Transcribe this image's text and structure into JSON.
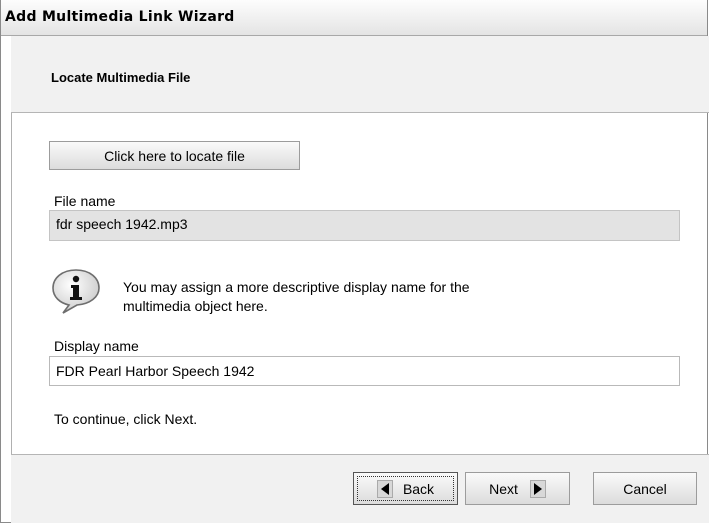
{
  "window": {
    "title": "Add Multimedia Link Wizard"
  },
  "header": {
    "heading": "Locate Multimedia File"
  },
  "body": {
    "locate_button_label": "Click here to locate file",
    "file_name_label": "File name",
    "file_name_value": "fdr speech 1942.mp3",
    "info_icon": "info-icon",
    "info_text": "You may assign a more descriptive display name for the multimedia object here.",
    "display_name_label": "Display name",
    "display_name_value": "FDR Pearl Harbor Speech 1942",
    "continue_text": "To continue, click Next."
  },
  "footer": {
    "back_label": "Back",
    "next_label": "Next",
    "cancel_label": "Cancel"
  }
}
